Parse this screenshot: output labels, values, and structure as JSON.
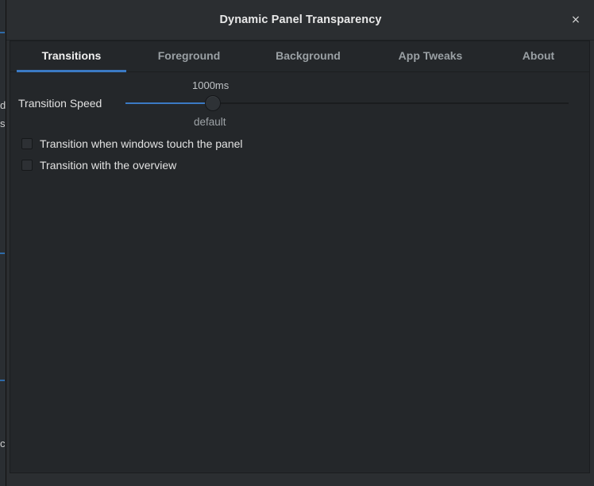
{
  "window": {
    "title": "Dynamic Panel Transparency",
    "close_glyph": "×"
  },
  "background_fragments": [
    "d",
    "s",
    "c"
  ],
  "tabs": [
    {
      "label": "Transitions",
      "active": true
    },
    {
      "label": "Foreground",
      "active": false
    },
    {
      "label": "Background",
      "active": false
    },
    {
      "label": "App Tweaks",
      "active": false
    },
    {
      "label": "About",
      "active": false
    }
  ],
  "transition_speed": {
    "label": "Transition Speed",
    "value_text": "1000ms",
    "value_fraction": 0.198,
    "mark_label": "default"
  },
  "options": [
    {
      "label": "Transition when windows touch the panel",
      "checked": false
    },
    {
      "label": "Transition with the overview",
      "checked": false
    }
  ],
  "colors": {
    "accent": "#3b7ac4",
    "dialog_bg": "#2b2e31",
    "content_bg": "#24272a"
  }
}
